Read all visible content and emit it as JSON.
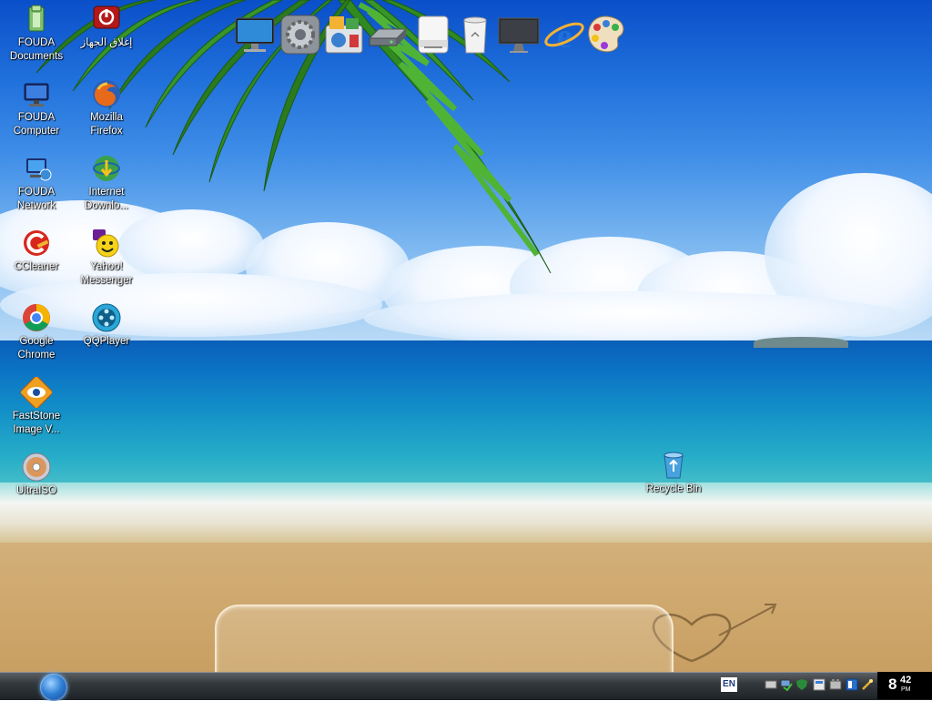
{
  "desktop": {
    "icons": [
      {
        "id": "fouda-documents",
        "label": "FOUDA\nDocuments",
        "icon": "documents-folder-icon"
      },
      {
        "id": "fouda-computer",
        "label": "FOUDA\nComputer",
        "icon": "computer-icon"
      },
      {
        "id": "fouda-network",
        "label": "FOUDA\nNetwork",
        "icon": "network-icon"
      },
      {
        "id": "ccleaner",
        "label": "CCleaner",
        "icon": "ccleaner-icon"
      },
      {
        "id": "google-chrome",
        "label": "Google\nChrome",
        "icon": "chrome-icon"
      },
      {
        "id": "faststone",
        "label": "FastStone\nImage V...",
        "icon": "faststone-icon"
      },
      {
        "id": "ultraiso",
        "label": "UltraISO",
        "icon": "disc-icon"
      },
      {
        "id": "shutdown",
        "label": "إغلاق الجهاز",
        "icon": "power-icon"
      },
      {
        "id": "firefox",
        "label": "Mozilla\nFirefox",
        "icon": "firefox-icon"
      },
      {
        "id": "idm",
        "label": "Internet\nDownlo...",
        "icon": "download-manager-icon"
      },
      {
        "id": "yahoo",
        "label": "Yahoo!\nMessenger",
        "icon": "yahoo-messenger-icon"
      },
      {
        "id": "qqplayer",
        "label": "QQPlayer",
        "icon": "qqplayer-icon"
      },
      {
        "id": "recycle-bin",
        "label": "Recycle Bin",
        "icon": "recycle-bin-icon"
      }
    ]
  },
  "dock": {
    "items": [
      {
        "id": "monitor",
        "icon": "monitor-icon"
      },
      {
        "id": "settings",
        "icon": "gear-icon"
      },
      {
        "id": "photos",
        "icon": "photo-gallery-icon"
      },
      {
        "id": "drive",
        "icon": "hard-drive-icon"
      },
      {
        "id": "printer",
        "icon": "printer-icon"
      },
      {
        "id": "trash",
        "icon": "trash-icon"
      },
      {
        "id": "display",
        "icon": "display-icon"
      },
      {
        "id": "ie",
        "icon": "internet-explorer-icon"
      },
      {
        "id": "paint",
        "icon": "paint-palette-icon"
      }
    ]
  },
  "taskbar": {
    "start_icon": "windows-start-icon",
    "language": "EN",
    "tray_icons": [
      "keyboard-icon",
      "network-status-icon",
      "security-icon",
      "flag-icon",
      "volume-icon",
      "chat-icon",
      "power-icon"
    ],
    "clock": {
      "hour": "8",
      "minute": "42",
      "ampm": "PM"
    }
  },
  "colors": {
    "sky": "#1f6fdb",
    "sea": "#1492c8",
    "sand": "#cfa96f",
    "taskbar": "#1d2226"
  }
}
